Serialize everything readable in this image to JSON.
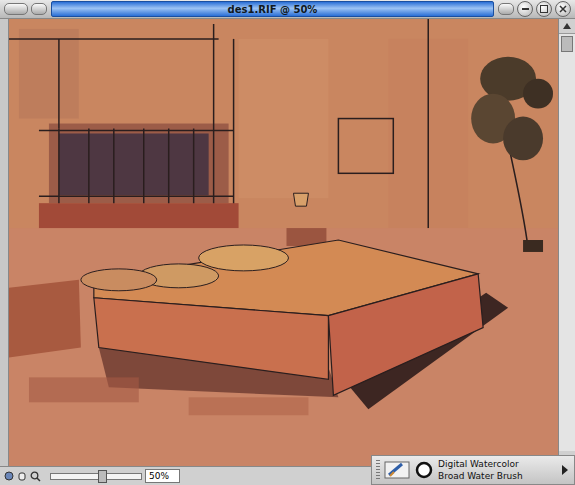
{
  "window": {
    "title": "des1.RIF @ 50%"
  },
  "status_bar": {
    "zoom": "50%",
    "zoom_level": 0.55
  },
  "brush_selector": {
    "category": "Digital Watercolor",
    "variant": "Broad Water Brush"
  }
}
